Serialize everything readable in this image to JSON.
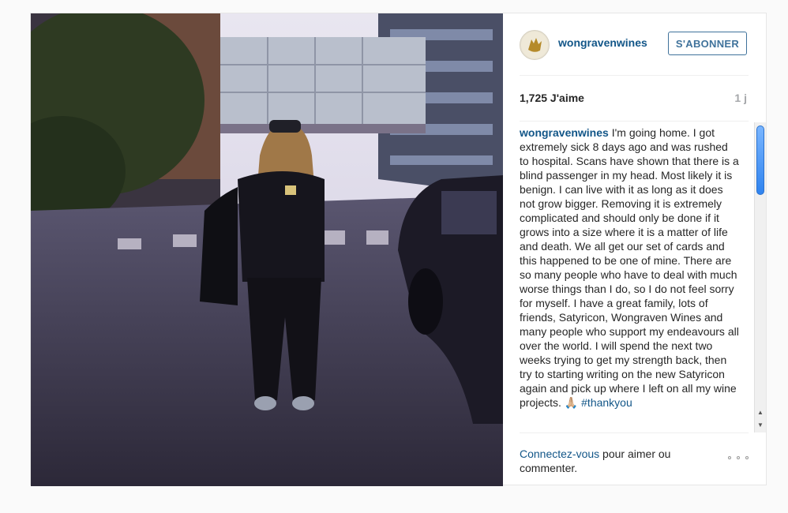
{
  "post": {
    "image_alt": "Photo"
  },
  "header": {
    "username": "wongravenwines",
    "follow_label": "S'ABONNER"
  },
  "stats": {
    "likes": "1,725 J'aime",
    "time": "1 j"
  },
  "caption": {
    "username": "wongravenwines",
    "text": " I'm going home. I got extremely sick 8 days ago and was rushed to hospital. Scans have shown that there is a blind passenger in my head. Most likely it is benign. I can live with it as long as it does not grow bigger. Removing it is extremely complicated and should only be done if it grows into a size where it is a matter of life and death. We all get our set of cards and this happened to be one of mine. There are so many people who have to deal with much worse things than I do, so I do not feel sorry for myself. I have a great family, lots of friends, Satyricon, Wongraven Wines and many people who support my endeavours all over the world. I will spend the next two weeks trying to get my strength back, then try to starting writing on the new Satyricon again and pick up where I left on all my wine projects. ",
    "emoji": "🙏🏼",
    "hashtag": " #thankyou"
  },
  "footer": {
    "login_link": "Connectez-vous",
    "login_rest": " pour aimer ou commenter."
  },
  "colors": {
    "link": "#125688",
    "follow_border": "#3f729b",
    "scroll_thumb": "#2f83ef"
  },
  "icons": {
    "more": "ellipsis-icon",
    "scroll_up": "up-arrow-icon",
    "scroll_down": "down-arrow-icon"
  }
}
